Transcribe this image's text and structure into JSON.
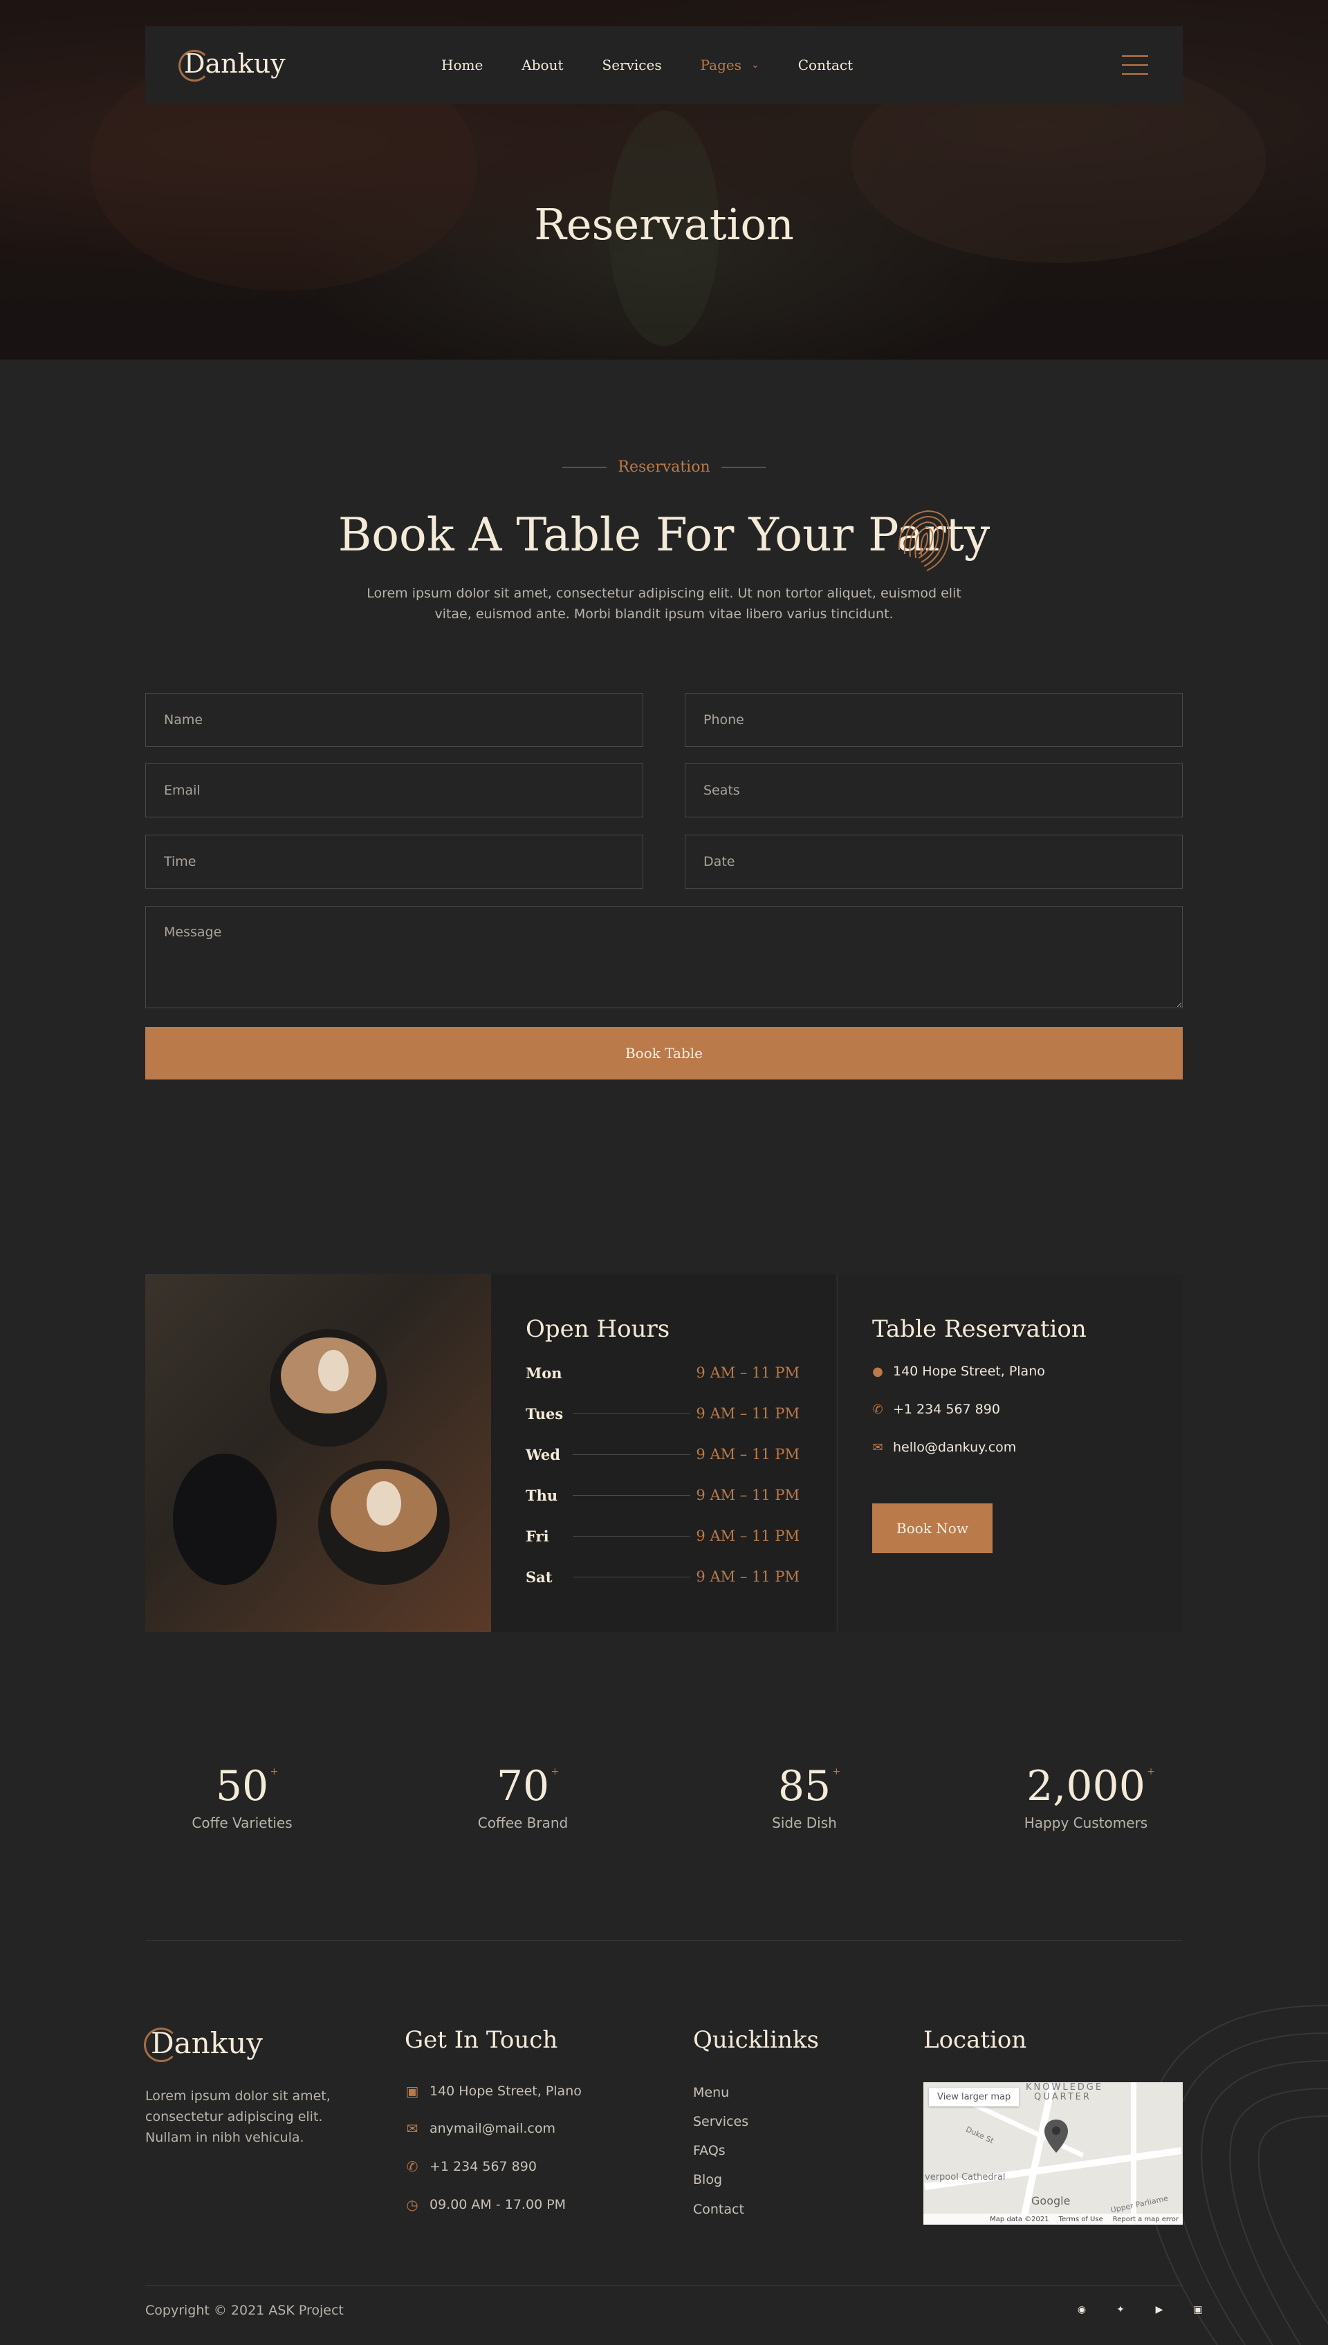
{
  "nav": {
    "logo": "Dankuy",
    "links": [
      "Home",
      "About",
      "Services",
      "Pages",
      "Contact"
    ],
    "active_index": 3
  },
  "hero": {
    "title": "Reservation"
  },
  "section": {
    "eyebrow": "Reservation",
    "title": "Book A Table For Your Party",
    "description": "Lorem ipsum dolor sit amet, consectetur adipiscing elit. Ut non tortor aliquet, euismod elit vitae, euismod ante. Morbi blandit ipsum vitae libero varius tincidunt."
  },
  "form": {
    "name_placeholder": "Name",
    "phone_placeholder": "Phone",
    "email_placeholder": "Email",
    "seats_placeholder": "Seats",
    "time_placeholder": "Time",
    "date_placeholder": "Date",
    "message_placeholder": "Message",
    "submit_label": "Book Table"
  },
  "hours": {
    "title": "Open Hours",
    "rows": [
      {
        "day": "Mon",
        "time": "9 AM – 11 PM"
      },
      {
        "day": "Tues",
        "time": "9 AM – 11 PM"
      },
      {
        "day": "Wed",
        "time": "9 AM – 11 PM"
      },
      {
        "day": "Thu",
        "time": "9 AM – 11 PM"
      },
      {
        "day": "Fri",
        "time": "9 AM – 11 PM"
      },
      {
        "day": "Sat",
        "time": "9 AM – 11 PM"
      }
    ]
  },
  "reservation": {
    "title": "Table Reservation",
    "address": "140 Hope Street, Plano",
    "phone": "+1 234 567 890",
    "email": "hello@dankuy.com",
    "button": "Book Now"
  },
  "stats": [
    {
      "value": "50",
      "label": "Coffe Varieties"
    },
    {
      "value": "70",
      "label": "Coffee Brand"
    },
    {
      "value": "85",
      "label": "Side Dish"
    },
    {
      "value": "2,000",
      "label": "Happy Customers"
    }
  ],
  "stat_suffix": "+",
  "footer": {
    "logo": "Dankuy",
    "description": "Lorem ipsum dolor sit amet, consectetur adipiscing elit. Nullam in nibh vehicula.",
    "contact_title": "Get In Touch",
    "contact_items": [
      "140 Hope Street, Plano",
      "anymail@mail.com",
      "+1 234 567 890",
      "09.00 AM - 17.00 PM"
    ],
    "quick_title": "Quicklinks",
    "quick_links": [
      "Menu",
      "Services",
      "FAQs",
      "Blog",
      "Contact"
    ],
    "location_title": "Location",
    "map": {
      "larger_label": "View larger map",
      "labels": [
        "KNOWLEDGE",
        "QUARTER",
        "Duke St",
        "verpool Cathedral",
        "Upper Parliame",
        "Google"
      ],
      "attribution": [
        "Map data ©2021",
        "Terms of Use",
        "Report a map error"
      ]
    },
    "copyright": "Copyright © 2021 ASK Project"
  },
  "colors": {
    "accent": "#bb7a4a",
    "background": "#242424",
    "heading": "#f4ead8"
  }
}
